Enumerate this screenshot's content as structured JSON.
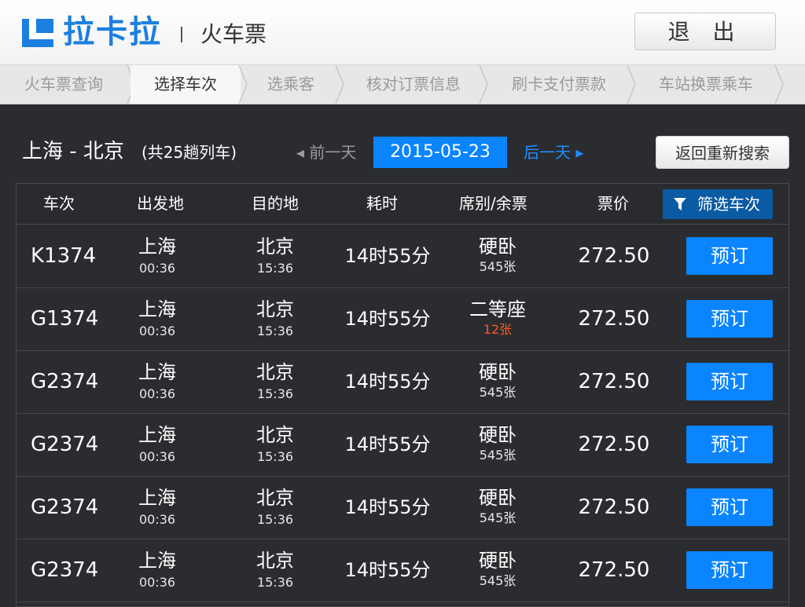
{
  "header": {
    "brand": "拉卡拉",
    "subtitle": "火车票",
    "logout": "退 出",
    "brand_color": "#1a7fe0"
  },
  "steps": [
    {
      "label": "火车票查询",
      "active": false
    },
    {
      "label": "选择车次",
      "active": true
    },
    {
      "label": "选乘客",
      "active": false
    },
    {
      "label": "核对订票信息",
      "active": false
    },
    {
      "label": "刷卡支付票款",
      "active": false
    },
    {
      "label": "车站换票乘车",
      "active": false
    }
  ],
  "search": {
    "route": "上海 - 北京",
    "count": "(共25趟列车)",
    "prev_day": "◂ 前一天",
    "date": "2015-05-23",
    "next_day": "后一天 ▸",
    "research": "返回重新搜索"
  },
  "table": {
    "headers": {
      "train": "车次",
      "from": "出发地",
      "to": "目的地",
      "duration": "耗时",
      "seat": "席别/余票",
      "price": "票价",
      "filter": "筛选车次"
    },
    "book_label": "预订",
    "rows": [
      {
        "train": "K1374",
        "from": "上海",
        "dep": "00:36",
        "to": "北京",
        "arr": "15:36",
        "duration": "14时55分",
        "seat": "硬卧",
        "left": "545张",
        "price": "272.50"
      },
      {
        "train": "G1374",
        "from": "上海",
        "dep": "00:36",
        "to": "北京",
        "arr": "15:36",
        "duration": "14时55分",
        "seat": "二等座",
        "left": "12张",
        "price": "272.50",
        "low": true
      },
      {
        "train": "G2374",
        "from": "上海",
        "dep": "00:36",
        "to": "北京",
        "arr": "15:36",
        "duration": "14时55分",
        "seat": "硬卧",
        "left": "545张",
        "price": "272.50"
      },
      {
        "train": "G2374",
        "from": "上海",
        "dep": "00:36",
        "to": "北京",
        "arr": "15:36",
        "duration": "14时55分",
        "seat": "硬卧",
        "left": "545张",
        "price": "272.50"
      },
      {
        "train": "G2374",
        "from": "上海",
        "dep": "00:36",
        "to": "北京",
        "arr": "15:36",
        "duration": "14时55分",
        "seat": "硬卧",
        "left": "545张",
        "price": "272.50"
      },
      {
        "train": "G2374",
        "from": "上海",
        "dep": "00:36",
        "to": "北京",
        "arr": "15:36",
        "duration": "14时55分",
        "seat": "硬卧",
        "left": "545张",
        "price": "272.50"
      }
    ]
  },
  "colors": {
    "accent": "#0a84ff",
    "filter": "#0a5ba3",
    "warning": "#ff5a1f",
    "background": "#2b2c30"
  }
}
